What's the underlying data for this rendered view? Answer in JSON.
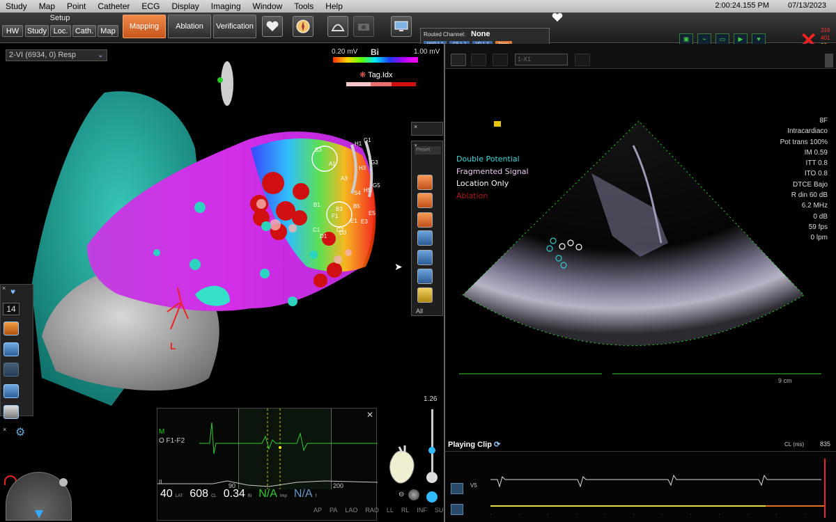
{
  "menu": {
    "items": [
      "Study",
      "Map",
      "Point",
      "Catheter",
      "ECG",
      "Display",
      "Imaging",
      "Window",
      "Tools",
      "Help"
    ],
    "time": "2:00:24.155 PM",
    "date": "07/13/2023"
  },
  "toolbar": {
    "setup_label": "Setup",
    "setup_tabs": [
      "HW",
      "Study",
      "Loc.",
      "Cath.",
      "Map"
    ],
    "workflow": [
      "Mapping",
      "Ablation",
      "Verification"
    ],
    "active_workflow": "Mapping",
    "routed_channel_label": "Routed Channel:",
    "routed_channel_value": "None",
    "channel_chips": [
      "MAP 1-2",
      "CS 1-2",
      "VD 1-2",
      "None"
    ],
    "status_numbers": [
      "319",
      "401",
      "80"
    ]
  },
  "viewer": {
    "map_select": "2-VI (6934, 0) Resp",
    "scale_min": "0.20 mV",
    "scale_type": "Bi",
    "scale_max": "1.00 mV",
    "tag_label": "Tag.Idx",
    "orientation_label": "L",
    "left_toolbox_number": "14",
    "right_toolbox_preset": "Preset",
    "right_toolbox_filter": "All",
    "zoom_value": "1.26",
    "view_labels": [
      "AP",
      "PA",
      "LAO",
      "RAO",
      "LL",
      "RL",
      "INF",
      "SUP"
    ],
    "catheter_labels": [
      "S3",
      "H1",
      "G1",
      "A1",
      "G3",
      "H3",
      "A3",
      "G5",
      "H5",
      "S4",
      "B1",
      "B3",
      "B5",
      "F1",
      "E1",
      "E3",
      "E5",
      "C1",
      "D1",
      "C3",
      "D3"
    ]
  },
  "ecg": {
    "m_label": "M",
    "channel": "O F1-F2",
    "ii_label": "II",
    "scale_90": "90",
    "scale_200": "200",
    "lat_value": "40",
    "lat_unit": "LAT",
    "cl_value": "608",
    "cl_unit": "CL",
    "bi_value": "0.34",
    "bi_unit": "Bi",
    "imp_value": "N/A",
    "imp_unit": "Imp",
    "other_value": "N/A",
    "other_unit": "f"
  },
  "echo": {
    "toolbar_select": "1-X1",
    "params": [
      "8F",
      "Intracardiaco",
      "Pot trans 100%",
      "IM 0.59",
      "ITT 0.8",
      "ITO 0.8",
      "DTCE Bajo",
      "R din 60 dB",
      "6.2 MHz",
      "0 dB",
      "59 fps",
      "0 lpm"
    ],
    "legend": [
      {
        "label": "Double Potential",
        "color": "#3fd7d7"
      },
      {
        "label": "Fragmented Signal",
        "color": "#f0a8f0"
      },
      {
        "label": "Location Only",
        "color": "#ffffff"
      },
      {
        "label": "Ablation",
        "color": "#b01818"
      }
    ],
    "depth": "9 cm",
    "playing_clip": "Playing Clip",
    "cl_label": "CL (ms)",
    "cl_value": "835",
    "strip_lead": "V5"
  }
}
